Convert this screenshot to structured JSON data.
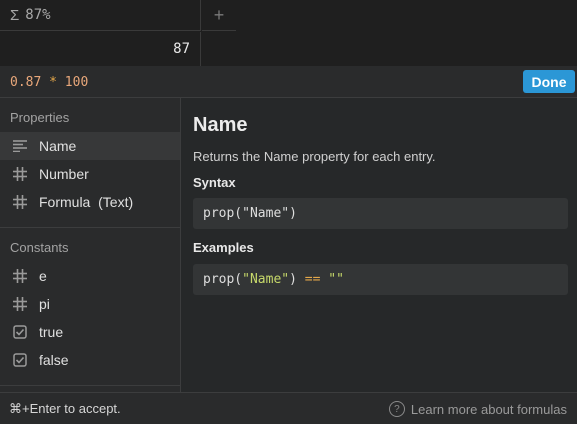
{
  "table": {
    "column_header": "87%",
    "column_icon": "sigma-icon",
    "add_column_icon": "plus-icon",
    "cell_value": "87"
  },
  "formula_bar": {
    "num1": "0.87",
    "operator": "*",
    "num2": "100",
    "done_label": "Done",
    "accent_color": "#2b97d6"
  },
  "sidebar": {
    "properties_title": "Properties",
    "properties": [
      {
        "label": "Name",
        "icon": "text-lines-icon",
        "selected": true
      },
      {
        "label": "Number",
        "icon": "hash-icon"
      },
      {
        "label": "Formula  (Text)",
        "icon": "hash-icon"
      }
    ],
    "constants_title": "Constants",
    "constants": [
      {
        "label": "e",
        "icon": "hash-icon"
      },
      {
        "label": "pi",
        "icon": "hash-icon"
      },
      {
        "label": "true",
        "icon": "checkbox-icon"
      },
      {
        "label": "false",
        "icon": "checkbox-icon"
      }
    ]
  },
  "detail": {
    "title": "Name",
    "description": "Returns the Name property for each entry.",
    "syntax_label": "Syntax",
    "syntax_code": "prop(\"Name\")",
    "examples_label": "Examples",
    "example": {
      "fn_open": "prop(",
      "arg": "\"Name\"",
      "fn_close": ")",
      "op": "==",
      "rhs": "\"\""
    }
  },
  "footer": {
    "hint": "⌘+Enter to accept.",
    "learn_more": "Learn more about formulas",
    "help_icon": "question-circle-icon"
  }
}
